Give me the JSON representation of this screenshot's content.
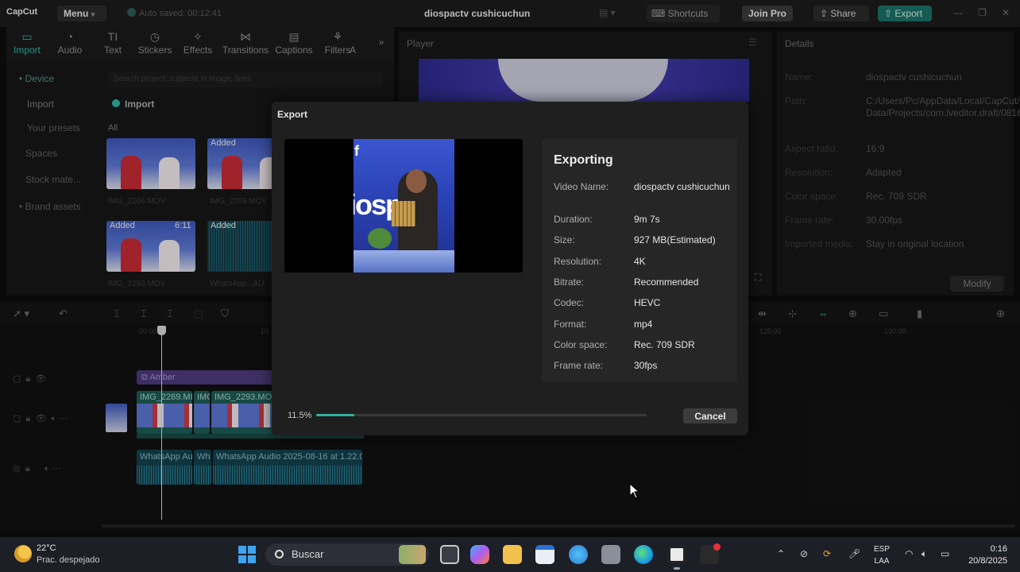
{
  "app": {
    "logo": "CapCut",
    "menu_label": "Menu",
    "autosave": "Auto saved: 00:12:41",
    "project_title": "diospactv cushicuchun",
    "shortcuts_label": "Shortcuts",
    "join_pro_label": "Join Pro",
    "share_label": "Share",
    "export_label": "Export",
    "accent_color": "#2fb3a4"
  },
  "tool_tabs": [
    {
      "label": "Import",
      "icon": "import-icon"
    },
    {
      "label": "Audio",
      "icon": "audio-icon"
    },
    {
      "label": "Text",
      "icon": "text-icon"
    },
    {
      "label": "Stickers",
      "icon": "stickers-icon"
    },
    {
      "label": "Effects",
      "icon": "effects-icon"
    },
    {
      "label": "Transitions",
      "icon": "transitions-icon"
    },
    {
      "label": "Captions",
      "icon": "captions-icon"
    },
    {
      "label": "Filters",
      "icon": "filters-icon"
    },
    {
      "label": "A",
      "icon": "adjust-icon"
    }
  ],
  "left_nav": {
    "items": [
      "Device",
      "Import",
      "Your presets",
      "Spaces",
      "Stock mate...",
      "Brand assets"
    ]
  },
  "media": {
    "search_placeholder": "Search project, subjects in image, lines",
    "import_label": "Import",
    "all_label": "All",
    "added_badge": "Added",
    "thumb_duration": "6:11",
    "items": [
      {
        "name": "IMG_2266.MOV"
      },
      {
        "name": "IMG_2269.MOV"
      },
      {
        "name": "IMG_2293.MOV"
      },
      {
        "name": "WhatsApp...AU"
      }
    ]
  },
  "player": {
    "title": "Player"
  },
  "details": {
    "title": "Details",
    "rows": [
      {
        "label": "Name:",
        "value": "diospactv cushicuchun"
      },
      {
        "label": "Path:",
        "value": "C:/Users/Pc/AppData/Local/CapCut/User Data/Projects/com.lveditor.draft/0816"
      },
      {
        "label": "Aspect ratio:",
        "value": "16:9"
      },
      {
        "label": "Resolution:",
        "value": "Adapted"
      },
      {
        "label": "Color space:",
        "value": "Rec. 709 SDR"
      },
      {
        "label": "Frame rate:",
        "value": "30.00fps"
      },
      {
        "label": "Imported media:",
        "value": "Stay in original location"
      }
    ],
    "modify_label": "Modify"
  },
  "timeline": {
    "ruler": [
      "00:00",
      "10",
      "125:00",
      "130:00"
    ],
    "amber_clip": "Amber",
    "video_clips": [
      "IMG_2269.MI",
      "IMG",
      "IMG_2293.MOV"
    ],
    "cover_label": "Cover",
    "audio_clips": [
      "WhatsApp Au",
      "Wh",
      "WhatsApp Audio 2025-08-16 at 1.22.0"
    ]
  },
  "export_dialog": {
    "title": "Export",
    "status_title": "Exporting",
    "rows": [
      {
        "label": "Video Name:",
        "value": "diospactv cushicuchun"
      },
      {
        "label": "Duration:",
        "value": "9m 7s"
      },
      {
        "label": "Size:",
        "value": "927 MB(Estimated)"
      },
      {
        "label": "Resolution:",
        "value": "4K"
      },
      {
        "label": "Bitrate:",
        "value": "Recommended"
      },
      {
        "label": "Codec:",
        "value": "HEVC"
      },
      {
        "label": "Format:",
        "value": "mp4"
      },
      {
        "label": "Color space:",
        "value": "Rec. 709 SDR"
      },
      {
        "label": "Frame rate:",
        "value": "30fps"
      }
    ],
    "progress_text": "11.5%",
    "progress_fraction": 0.115,
    "cancel_label": "Cancel"
  },
  "taskbar": {
    "temperature": "22°C",
    "condition": "Prac. despejado",
    "search_label": "Buscar",
    "lang_top": "ESP",
    "lang_bottom": "LAA",
    "time": "0:16",
    "date": "20/8/2025"
  }
}
